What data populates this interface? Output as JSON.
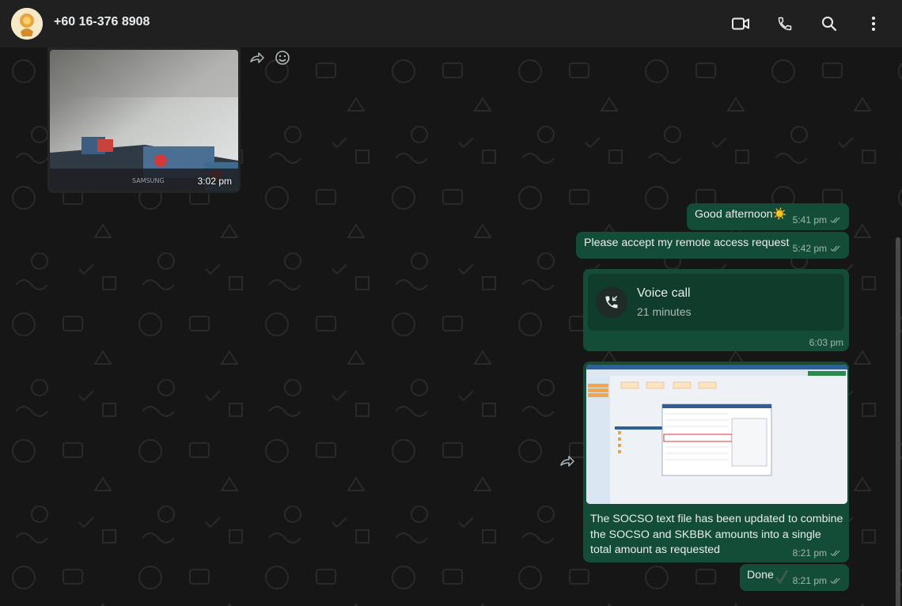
{
  "header": {
    "contact": "+60 16-376 8908",
    "icons": [
      "video-call-icon",
      "voice-call-icon",
      "search-icon",
      "menu-icon"
    ]
  },
  "messages": {
    "image_in": {
      "time": "3:02 pm",
      "caption_brand": "SAMSUNG"
    },
    "greeting": {
      "text": "Good afternoon",
      "emoji": "☀️",
      "time": "5:41 pm"
    },
    "remote": {
      "text": "Please accept my remote access request",
      "time": "5:42 pm"
    },
    "call": {
      "title": "Voice call",
      "duration": "21 minutes",
      "time": "6:03 pm"
    },
    "socso": {
      "text": "The SOCSO text file has been updated to combine the SOCSO and SKBBK amounts into a single total amount as requested",
      "time": "8:21 pm"
    },
    "done": {
      "text": "Done",
      "time": "8:21 pm"
    }
  },
  "colors": {
    "outgoing": "#144d37",
    "incoming": "#242626",
    "header": "#202020",
    "background": "#161616",
    "tick": "#8ba79b"
  }
}
